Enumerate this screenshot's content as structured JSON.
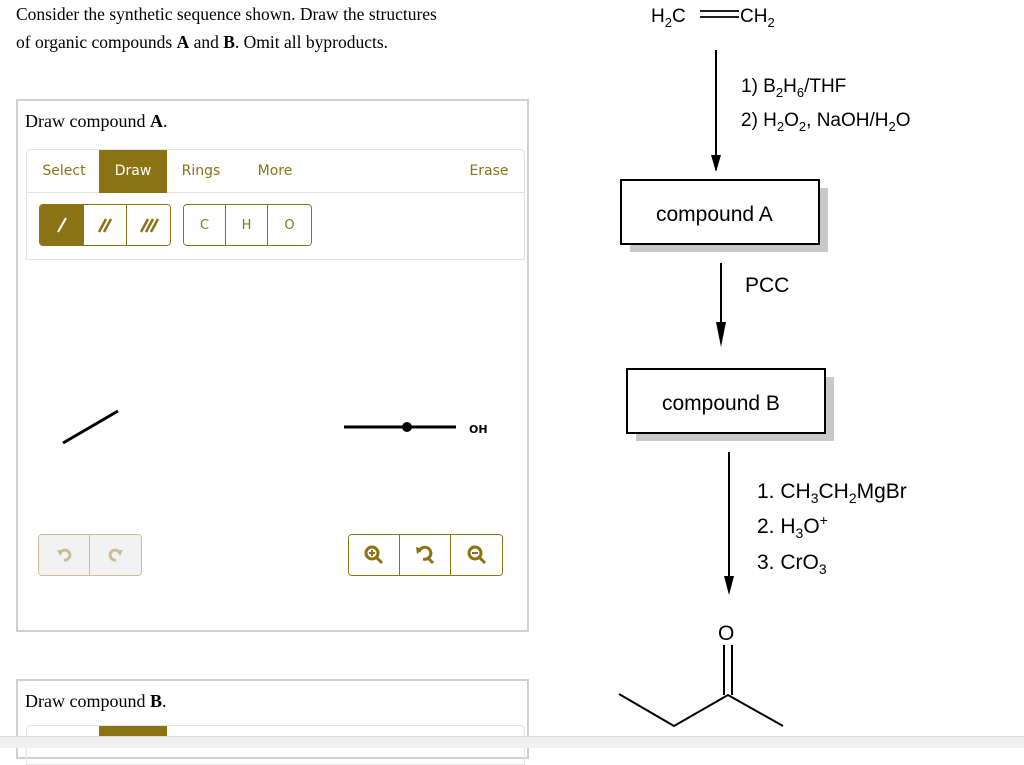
{
  "question": {
    "line1": "Consider the synthetic sequence shown. Draw the structures",
    "line2_prefix": "of organic compounds ",
    "bold_a": "A",
    "and": " and ",
    "bold_b": "B",
    "line2_suffix": ". Omit all byproducts."
  },
  "panel_a": {
    "title_prefix": "Draw compound ",
    "title_bold": "A",
    "title_suffix": ".",
    "tabs": [
      {
        "label": "Select",
        "active": false
      },
      {
        "label": "Draw",
        "active": true
      },
      {
        "label": "Rings",
        "active": false
      },
      {
        "label": "More",
        "active": false
      }
    ],
    "erase_label": "Erase",
    "bond_buttons": [
      {
        "name": "single-bond",
        "icon": "/",
        "active": true
      },
      {
        "name": "double-bond",
        "icon": "//",
        "active": false
      },
      {
        "name": "triple-bond",
        "icon": "///",
        "active": false
      }
    ],
    "atom_buttons": [
      "C",
      "H",
      "O"
    ],
    "canvas_label_oh": "OH",
    "history_buttons": [
      "undo-icon",
      "redo-icon"
    ],
    "zoom_buttons": [
      "zoom-in-icon",
      "reset-zoom-icon",
      "zoom-out-icon"
    ]
  },
  "panel_b": {
    "title_prefix": "Draw compound ",
    "title_bold": "B",
    "title_suffix": "."
  },
  "scheme": {
    "start_material": {
      "left": "H",
      "left_sub": "2",
      "left_c": "C",
      "right_c": "CH",
      "right_sub": "2"
    },
    "step1": {
      "line1": [
        "1) B",
        "2",
        "H",
        "6",
        "/THF"
      ],
      "line2": [
        "2) H",
        "2",
        "O",
        "2",
        ", NaOH/H",
        "2",
        "O"
      ]
    },
    "box_a": "compound A",
    "step2": "PCC",
    "box_b": "compound B",
    "step3": {
      "line1": [
        "1. CH",
        "3",
        "CH",
        "2",
        "MgBr"
      ],
      "line2": [
        "2. H",
        "3",
        "O",
        "+"
      ],
      "line3": [
        "3. CrO",
        "3"
      ]
    },
    "product_o": "O"
  },
  "colors": {
    "accent": "#8b7315",
    "panel_border": "#d0d0d0",
    "disabled_border": "#c9bf97"
  }
}
